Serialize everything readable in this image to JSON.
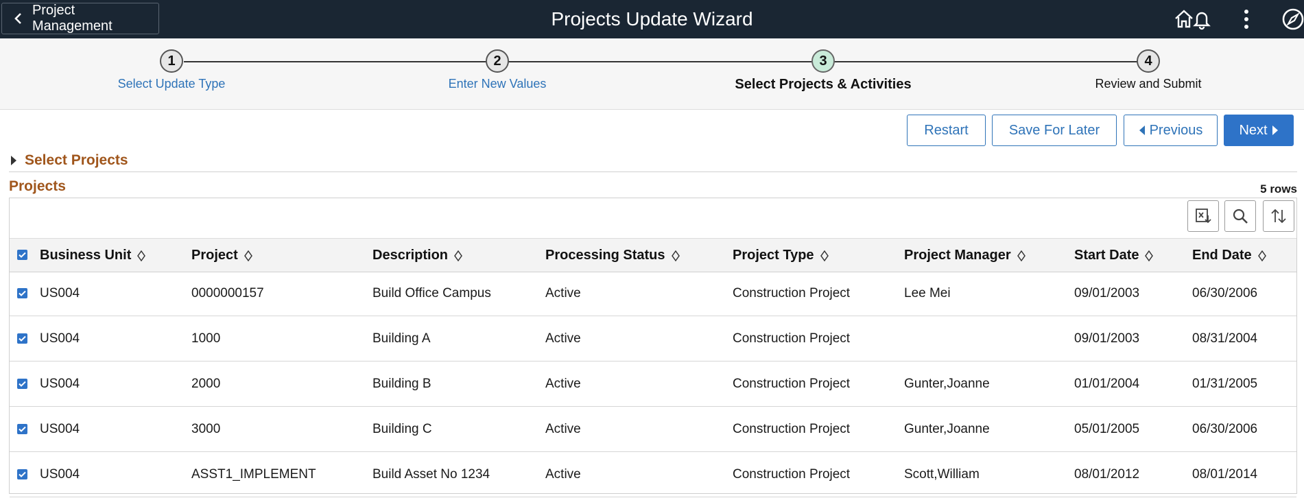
{
  "header": {
    "back_label": "Project Management",
    "title": "Projects Update Wizard",
    "icons": [
      "home-icon",
      "bell-icon",
      "more-vertical-icon",
      "navbar-compass-icon"
    ]
  },
  "steps": [
    {
      "number": "1",
      "label": "Select Update Type"
    },
    {
      "number": "2",
      "label": "Enter New Values"
    },
    {
      "number": "3",
      "label": "Select Projects & Activities"
    },
    {
      "number": "4",
      "label": "Review and Submit"
    }
  ],
  "actions": {
    "restart": "Restart",
    "save_for_later": "Save For Later",
    "previous": "Previous",
    "next": "Next"
  },
  "select_projects": {
    "label": "Select Projects"
  },
  "projects_grid": {
    "title": "Projects",
    "row_count": "5 rows",
    "toolbar_icons": [
      "export-excel-icon",
      "search-icon",
      "sort-icon"
    ],
    "columns": [
      "Business Unit",
      "Project",
      "Description",
      "Processing Status",
      "Project Type",
      "Project Manager",
      "Start Date",
      "End Date"
    ],
    "rows": [
      [
        "US004",
        "0000000157",
        "Build Office Campus",
        "Active",
        "Construction Project",
        "Lee Mei",
        "09/01/2003",
        "06/30/2006"
      ],
      [
        "US004",
        "1000",
        "Building A",
        "Active",
        "Construction Project",
        "",
        "09/01/2003",
        "08/31/2004"
      ],
      [
        "US004",
        "2000",
        "Building B",
        "Active",
        "Construction Project",
        "Gunter,Joanne",
        "01/01/2004",
        "01/31/2005"
      ],
      [
        "US004",
        "3000",
        "Building C",
        "Active",
        "Construction Project",
        "Gunter,Joanne",
        "05/01/2005",
        "06/30/2006"
      ],
      [
        "US004",
        "ASST1_IMPLEMENT",
        "Build Asset No 1234",
        "Active",
        "Construction Project",
        "Scott,William",
        "08/01/2012",
        "08/01/2014"
      ]
    ]
  },
  "colors": {
    "banner": "#1a2633",
    "accent": "#2e73c8",
    "section_title": "#a0561c",
    "active_step": "#c9ebd9"
  }
}
